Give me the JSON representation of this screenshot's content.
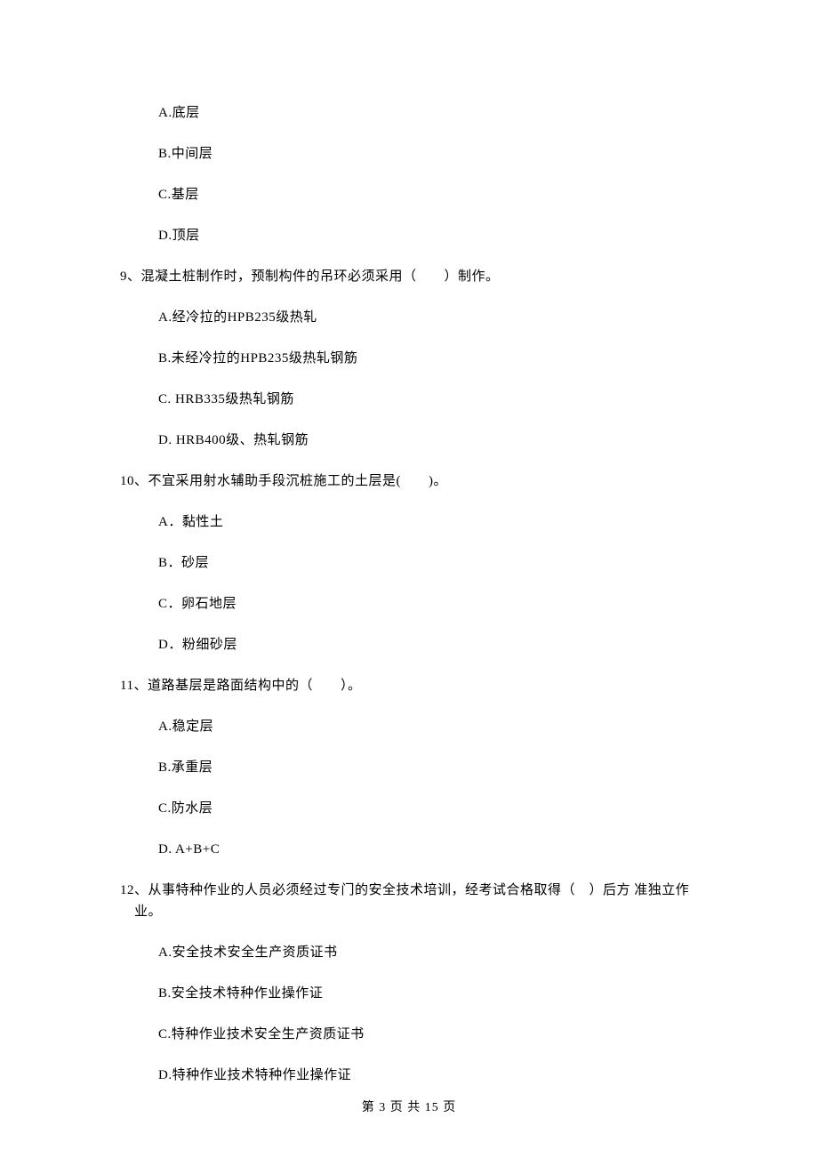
{
  "q8": {
    "options": {
      "a": "A.底层",
      "b": "B.中间层",
      "c": "C.基层",
      "d": "D.顶层"
    }
  },
  "q9": {
    "text": "9、混凝土桩制作时，预制构件的吊环必须采用（　　）制作。",
    "options": {
      "a": "A.经冷拉的HPB235级热轧",
      "b": "B.未经冷拉的HPB235级热轧钢筋",
      "c": "C. HRB335级热轧钢筋",
      "d": "D. HRB400级、热轧钢筋"
    }
  },
  "q10": {
    "text": "10、不宜采用射水辅助手段沉桩施工的土层是(　　)。",
    "options": {
      "a": "A．黏性土",
      "b": "B．砂层",
      "c": "C．卵石地层",
      "d": "D．粉细砂层"
    }
  },
  "q11": {
    "text": "11、道路基层是路面结构中的（　　）。",
    "options": {
      "a": "A.稳定层",
      "b": "B.承重层",
      "c": "C.防水层",
      "d": "D. A+B+C"
    }
  },
  "q12": {
    "text": "12、从事特种作业的人员必须经过专门的安全技术培训，经考试合格取得（　）后方 准独立作业。",
    "options": {
      "a": "A.安全技术安全生产资质证书",
      "b": "B.安全技术特种作业操作证",
      "c": "C.特种作业技术安全生产资质证书",
      "d": "D.特种作业技术特种作业操作证"
    }
  },
  "footer": "第 3 页 共 15 页"
}
